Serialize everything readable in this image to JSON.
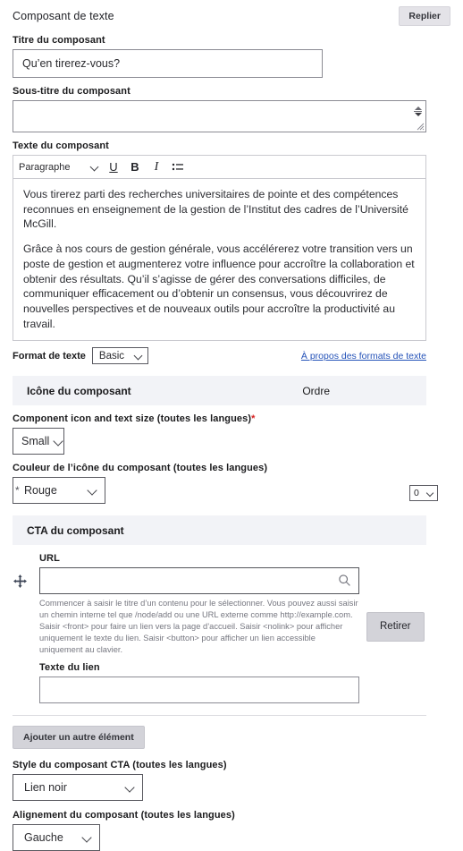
{
  "component": {
    "title": "Composant de texte",
    "collapse_label": "Replier"
  },
  "fields": {
    "title": {
      "label": "Titre du composant",
      "value": "Qu’en tirerez-vous?",
      "placeholder": ""
    },
    "subtitle": {
      "label": "Sous-titre du composant",
      "value": "",
      "placeholder": ""
    },
    "body": {
      "label": "Texte du composant",
      "toolbar": {
        "format_select": "Paragraphe",
        "underline": "U",
        "bold": "B",
        "italic": "I",
        "list_icon": "bulleted-list-icon"
      },
      "paragraphs": [
        "Vous tirerez parti des recherches universitaires de pointe et des compétences reconnues en enseignement de la gestion de l’Institut des cadres de l’Université McGill.",
        "Grâce à nos cours de gestion générale, vous accélérerez votre transition vers un poste de gestion et augmenterez votre influence pour accroître la collaboration et obtenir des résultats. Qu’il s’agisse de gérer des conversations difficiles, de communiquer efficacement ou d’obtenir un consensus, vous découvrirez de nouvelles perspectives et de nouveaux outils pour accroître la productivité au travail."
      ]
    },
    "text_format": {
      "label": "Format de texte",
      "value": "Basic",
      "help_link": "À propos des formats de texte"
    }
  },
  "icon_section": {
    "band_title": "Icône du composant",
    "band_right": "Ordre",
    "order_value": "0",
    "size": {
      "label": "Component icon and text size (toutes les langues)",
      "required_marker": "*",
      "value": "Small"
    },
    "color": {
      "label": "Couleur de l’icône du composant (toutes les langues)",
      "value": "Rouge",
      "side_marker": "*"
    }
  },
  "cta_section": {
    "band_title": "CTA du composant",
    "url": {
      "label": "URL",
      "value": "",
      "placeholder": "",
      "search_icon": "search-icon"
    },
    "description": "Commencer à saisir le titre d’un contenu pour le sélectionner. Vous pouvez aussi saisir un chemin interne tel que /node/add ou une URL externe comme http://example.com. Saisir <front> pour faire un lien vers la page d’accueil. Saisir <nolink> pour afficher uniquement le texte du lien. Saisir <button> pour afficher un lien accessible uniquement au clavier.",
    "remove_label": "Retirer",
    "drag_icon": "move-handle-icon",
    "link_text": {
      "label": "Texte du lien",
      "value": "",
      "placeholder": ""
    },
    "add_label": "Ajouter un autre élément"
  },
  "footer_fields": {
    "cta_style": {
      "label": "Style du composant CTA (toutes les langues)",
      "value": "Lien noir"
    },
    "alignment": {
      "label": "Alignement du composant (toutes les langues)",
      "value": "Gauche"
    }
  },
  "colors": {
    "band_bg": "#f2f3f7",
    "button_bg": "#d3d3d9",
    "link": "#2452b8",
    "required": "#d72222"
  }
}
